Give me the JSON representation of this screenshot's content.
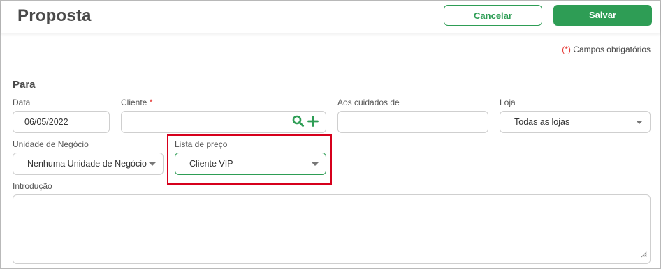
{
  "header": {
    "title": "Proposta",
    "cancel_label": "Cancelar",
    "save_label": "Salvar"
  },
  "required_note": {
    "mark": "(*)",
    "text": " Campos obrigatórios"
  },
  "section_title": "Para",
  "form": {
    "data": {
      "label": "Data",
      "value": "06/05/2022"
    },
    "cliente": {
      "label": "Cliente",
      "required_mark": "*",
      "value": "",
      "icons": [
        "search-icon",
        "add-icon"
      ]
    },
    "aos_cuidados": {
      "label": "Aos cuidados de",
      "value": ""
    },
    "loja": {
      "label": "Loja",
      "value": "Todas as lojas"
    },
    "unidade": {
      "label": "Unidade de Negócio",
      "value": "Nenhuma Unidade de Negócio"
    },
    "lista_preco": {
      "label": "Lista de preço",
      "value": "Cliente VIP"
    },
    "introducao": {
      "label": "Introdução",
      "value": ""
    }
  },
  "colors": {
    "accent": "#2e9d55",
    "required": "#e53935",
    "highlight": "#d6001c"
  }
}
